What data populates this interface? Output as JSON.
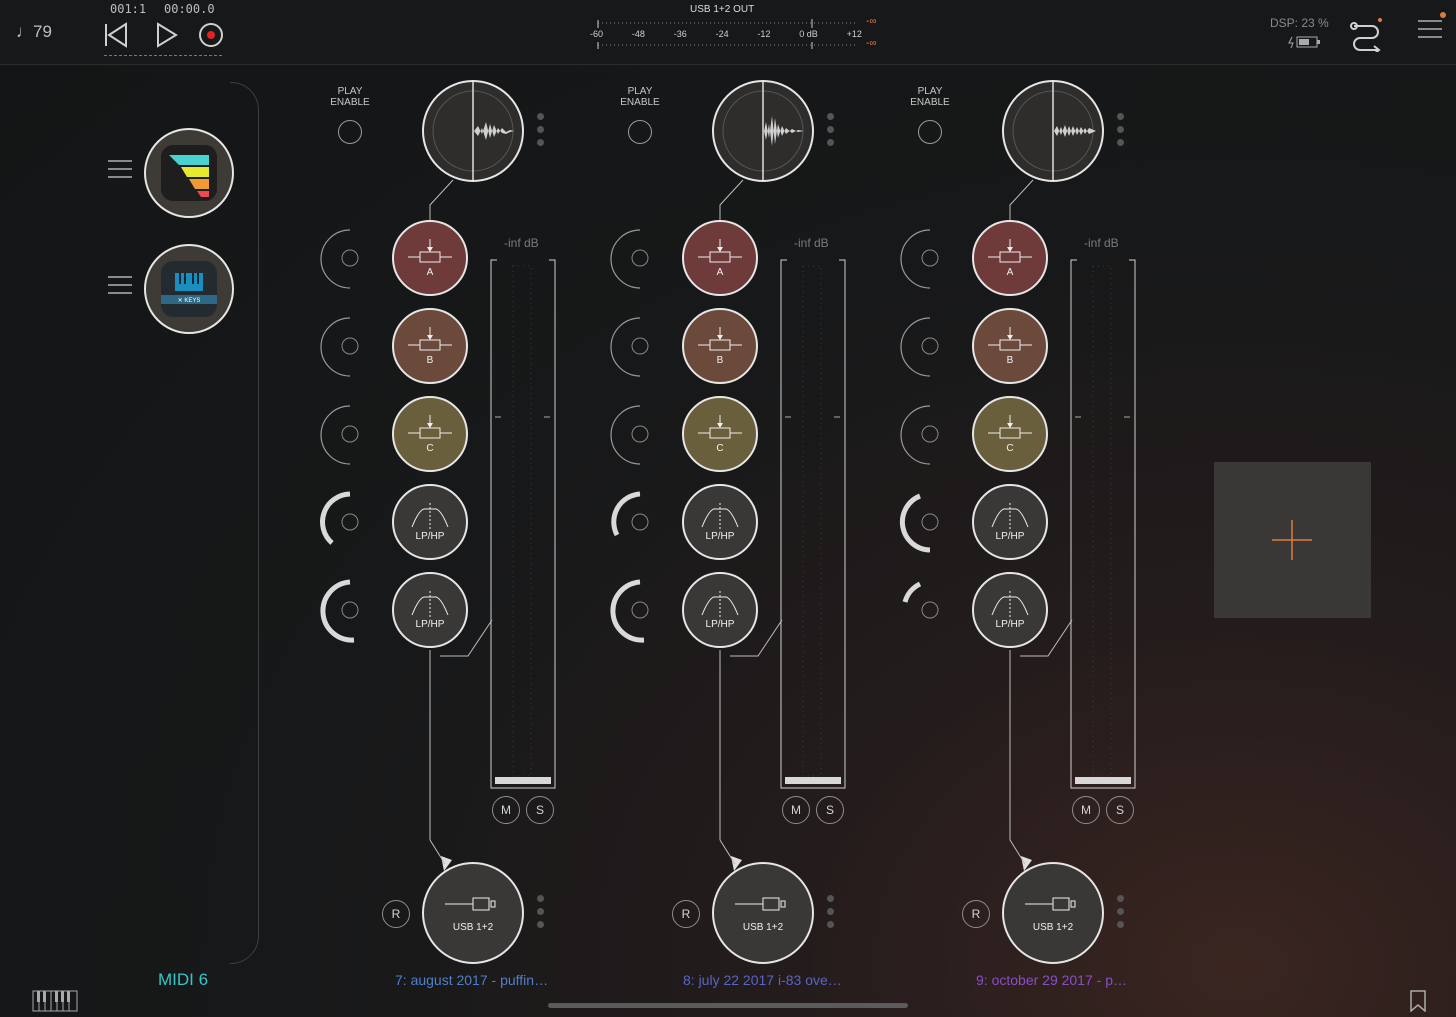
{
  "transport": {
    "tempo": "♩79",
    "position": "001:1",
    "time": "00:00.0"
  },
  "output": {
    "title": "USB 1+2 OUT",
    "scale": [
      "-60",
      "-48",
      "-36",
      "-24",
      "-12",
      "0 dB",
      "+12"
    ],
    "peak_top": "-∞",
    "peak_bottom": "-∞"
  },
  "status": {
    "dsp": "DSP: 23 %"
  },
  "sidebar": {
    "instruments": [
      {
        "name": "instrument-1",
        "icon": "colorful-stripes-app-icon"
      },
      {
        "name": "instrument-2",
        "icon": "keys-app-icon",
        "badge": "KEYS"
      }
    ],
    "midi_label": "MIDI 6"
  },
  "tracks": [
    {
      "play_enable": "PLAY\nENABLE",
      "fader_db": "-inf dB",
      "sends": [
        {
          "label": "A"
        },
        {
          "label": "B"
        },
        {
          "label": "C"
        }
      ],
      "filters": [
        {
          "label": "LP/HP"
        },
        {
          "label": "LP/HP"
        }
      ],
      "mute": "M",
      "solo": "S",
      "record": "R",
      "output_label": "USB 1+2",
      "name": "7: august 2017 - puffin…",
      "name_color": "#4f7fc9"
    },
    {
      "play_enable": "PLAY\nENABLE",
      "fader_db": "-inf dB",
      "sends": [
        {
          "label": "A"
        },
        {
          "label": "B"
        },
        {
          "label": "C"
        }
      ],
      "filters": [
        {
          "label": "LP/HP"
        },
        {
          "label": "LP/HP"
        }
      ],
      "mute": "M",
      "solo": "S",
      "record": "R",
      "output_label": "USB 1+2",
      "name": "8: july 22 2017 i-83 ove…",
      "name_color": "#5a63c9"
    },
    {
      "play_enable": "PLAY\nENABLE",
      "fader_db": "-inf dB",
      "sends": [
        {
          "label": "A"
        },
        {
          "label": "B"
        },
        {
          "label": "C"
        }
      ],
      "filters": [
        {
          "label": "LP/HP"
        },
        {
          "label": "LP/HP"
        }
      ],
      "mute": "M",
      "solo": "S",
      "record": "R",
      "output_label": "USB 1+2",
      "name": "9: october 29 2017 - p…",
      "name_color": "#8a4ec4"
    }
  ],
  "colors": {
    "send_a": "#6e3b3a",
    "send_b": "#6b4a3c",
    "send_c": "#6a5f3c",
    "filter": "#3a3836",
    "accent": "#e07a3c",
    "midi": "#35c7c9"
  },
  "icons": [
    "note-icon",
    "skip-back-icon",
    "play-icon",
    "record-icon",
    "battery-icon",
    "routing-icon",
    "menu-icon",
    "piano-keyboard-icon",
    "bookmark-icon",
    "add-icon"
  ]
}
